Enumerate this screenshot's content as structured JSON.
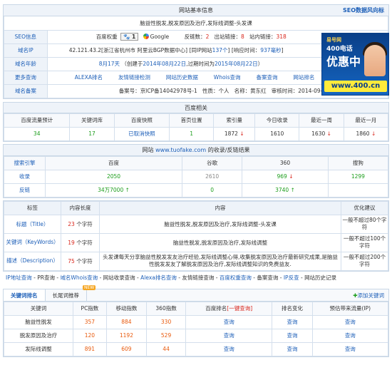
{
  "basic": {
    "title": "网站基本信息",
    "right_link": "SEO数据风向标",
    "site_desc": "脑益性脱发,脱发原因及治疗,发际线调整-头发课",
    "seo_label": "SEO信息",
    "baidu_weight_label": "百度权重",
    "baidu_weight_value": "1",
    "google_label": "Google",
    "backlinks_label": "反链数：",
    "backlinks_value": "2",
    "outlinks_label": "出站链接：",
    "outlinks_value": "8",
    "inlinks_label": "站内链接：",
    "inlinks_value": "318",
    "domain_ip_label": "域名IP",
    "domain_ip_value": "42.121.43.2[浙江省杭州市 阿里云BGP数据中心]",
    "same_ip_prefix": "[同IP网站",
    "same_ip_value": "137个",
    "same_ip_suffix": "]",
    "response_prefix": "[响应时间：",
    "response_value": "937毫秒",
    "response_suffix": "]",
    "domain_age_label": "域名年龄",
    "domain_age_value": "8月17天",
    "domain_age_detail_1": "（创建于",
    "domain_age_created": "2014年08月22日",
    "domain_age_detail_2": ",过期时间为",
    "domain_age_expire": "2015年08月22日",
    "domain_age_detail_3": "）",
    "more_label": "更多查询",
    "more_links": [
      "ALEXA排名",
      "友情链接检测",
      "网站历史数据",
      "Whois查询",
      "备案查询",
      "网站排名"
    ],
    "beian_label": "域名备案",
    "beian_no_label": "备案号：",
    "beian_no": "京ICP备14042978号-1",
    "beian_type_label": "性质：",
    "beian_type": "个人",
    "beian_name_label": "名称：",
    "beian_name": "黄东红",
    "beian_date_label": "审核时间：",
    "beian_date": "2014-09-09"
  },
  "ad": {
    "brand": "易号网",
    "line1": "400电话",
    "line2": "优惠中",
    "url": "www.400.cn"
  },
  "baidu": {
    "title": "百度相关",
    "headers": [
      "百度流量预计",
      "关键词库",
      "百度快照",
      "首页位置",
      "索引量",
      "今日收录",
      "最近一周",
      "最近一月"
    ],
    "row": [
      "34",
      "17",
      "已取消快照",
      "1",
      "1872",
      "1610",
      "1630",
      "1860"
    ]
  },
  "index": {
    "title_prefix": "网站 ",
    "title_site": "www.tuofake.com",
    "title_suffix": " 的收录/反链结果",
    "headers": [
      "搜索引擎",
      "百度",
      "谷歌",
      "360",
      "搜狗"
    ],
    "rows": [
      {
        "label": "收录",
        "values": [
          "2050",
          "2610",
          "969",
          "1299"
        ]
      },
      {
        "label": "反链",
        "values": [
          "34万7000",
          "0",
          "3740",
          ""
        ]
      }
    ]
  },
  "meta": {
    "headers": [
      "标签",
      "内容长度",
      "内容",
      "优化建议"
    ],
    "rows": [
      {
        "label": "标题（Title）",
        "len": "23",
        "unit": "个字符",
        "content": "脑益性脱发,脱发原因及治疗,发际线调整-头发课",
        "advice": "一般不超过80个字符"
      },
      {
        "label": "关键词（KeyWords）",
        "len": "19",
        "unit": "个字符",
        "content": "脑益性脱发,脱发原因及治疗,发际线调整",
        "advice": "一般不超过100个字符"
      },
      {
        "label": "描述（Description）",
        "len": "75",
        "unit": "个字符",
        "content": "头发课每天分享脑益性脱发发友治疗经验,发际线调整心得,收集脱发原因及治疗最新研究成果,是脑益性脱发发友了解脱发原因及治疗,发际线调整知识的免费益友.",
        "advice": "一般不超过200个字符"
      }
    ]
  },
  "linkbar": [
    "IP地址查询",
    "PR查询",
    "域名Whois查询",
    "网站收录查询",
    "Alexa排名查询",
    "友情链接查询",
    "百度权重查询",
    "备案查询",
    "IP反查",
    "网站历史记录"
  ],
  "keywords": {
    "tab_active": "关键词排名",
    "tab_other": "长尾词推荐",
    "badge": "NEW",
    "add_label": "添加关键词",
    "headers": [
      "关键词",
      "PC指数",
      "移动指数",
      "360指数",
      "百度排名[一键查询]",
      "排名变化",
      "预估带来流量(IP)"
    ],
    "rows": [
      {
        "kw": "脑益性脱发",
        "pc": "357",
        "mobile": "884",
        "i360": "330",
        "rank": "查询",
        "change": "查询",
        "flow": "查询"
      },
      {
        "kw": "脱发原因及治疗",
        "pc": "120",
        "mobile": "1192",
        "i360": "529",
        "rank": "查询",
        "change": "查询",
        "flow": "查询"
      },
      {
        "kw": "发际线调整",
        "pc": "891",
        "mobile": "609",
        "i360": "44",
        "rank": "查询",
        "change": "查询",
        "flow": "查询"
      }
    ]
  }
}
